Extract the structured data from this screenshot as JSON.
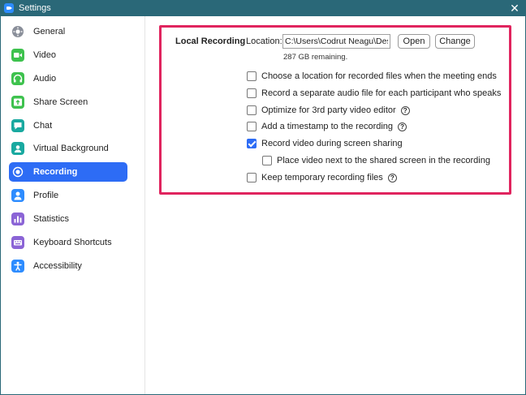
{
  "window": {
    "title": "Settings",
    "close_glyph": "✕"
  },
  "sidebar": {
    "items": [
      {
        "label": "General",
        "icon": "gear-icon",
        "color": "#8a8f9a"
      },
      {
        "label": "Video",
        "icon": "video-icon",
        "color": "#3ec24e"
      },
      {
        "label": "Audio",
        "icon": "headphones-icon",
        "color": "#3ec24e"
      },
      {
        "label": "Share Screen",
        "icon": "share-screen-icon",
        "color": "#3ec24e"
      },
      {
        "label": "Chat",
        "icon": "chat-icon",
        "color": "#19a9a0"
      },
      {
        "label": "Virtual Background",
        "icon": "person-background-icon",
        "color": "#19a9a0"
      },
      {
        "label": "Recording",
        "icon": "record-icon",
        "color": "#ffffff",
        "active": true
      },
      {
        "label": "Profile",
        "icon": "profile-icon",
        "color": "#2d8cff"
      },
      {
        "label": "Statistics",
        "icon": "statistics-icon",
        "color": "#8b64d6"
      },
      {
        "label": "Keyboard Shortcuts",
        "icon": "keyboard-icon",
        "color": "#8b64d6"
      },
      {
        "label": "Accessibility",
        "icon": "accessibility-icon",
        "color": "#2d8cff"
      }
    ]
  },
  "recording": {
    "section_label": "Local Recording",
    "location_label": "Location:",
    "location_value": "C:\\Users\\Codrut Neagu\\Desktop",
    "open_label": "Open",
    "change_label": "Change",
    "remaining": "287 GB remaining.",
    "help_glyph": "?",
    "options": [
      {
        "label": "Choose a location for recorded files when the meeting ends",
        "checked": false,
        "help": false
      },
      {
        "label": "Record a separate audio file for each participant who speaks",
        "checked": false,
        "help": false
      },
      {
        "label": "Optimize for 3rd party video editor",
        "checked": false,
        "help": true
      },
      {
        "label": "Add a timestamp to the recording",
        "checked": false,
        "help": true
      },
      {
        "label": "Record video during screen sharing",
        "checked": true,
        "help": false
      },
      {
        "label": "Place video next to the shared screen in the recording",
        "checked": false,
        "help": false,
        "indent": true
      },
      {
        "label": "Keep temporary recording files",
        "checked": false,
        "help": true
      }
    ]
  },
  "colors": {
    "accent": "#2d6cf5",
    "titlebar": "#2a6878",
    "highlight": "#e0245e"
  }
}
